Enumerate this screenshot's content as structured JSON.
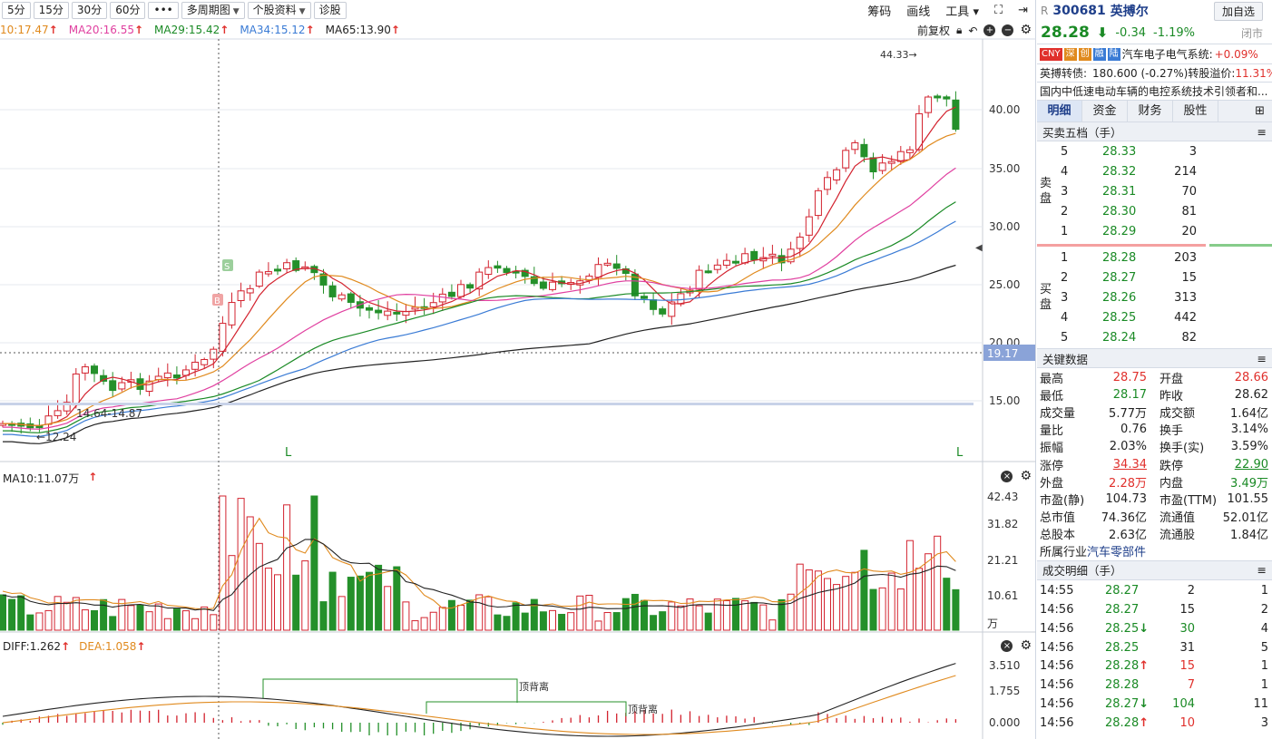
{
  "toolbar": {
    "periods": [
      "5分",
      "15分",
      "30分",
      "60分"
    ],
    "more": "•••",
    "multi": "多周期图",
    "profile": "个股资料",
    "diagnose": "诊股",
    "right": [
      "筹码",
      "画线",
      "工具"
    ]
  },
  "ma_legend": [
    {
      "label": "10:17.47",
      "color": "#e08a1e"
    },
    {
      "label": "MA20:16.55",
      "color": "#e040a0"
    },
    {
      "label": "MA29:15.42",
      "color": "#1a8a25"
    },
    {
      "label": "MA34:15.12",
      "color": "#3a7bd5"
    },
    {
      "label": "MA65:13.90",
      "color": "#222222"
    }
  ],
  "adj": "前复权",
  "price_axis": [
    "40.00",
    "35.00",
    "30.00",
    "25.00",
    "20.00",
    "15.00"
  ],
  "price_marks": {
    "high_label": "44.33→",
    "low_label": "←12.24",
    "range_label": "14.64-14.87",
    "cross_label": "19.17",
    "b": "B",
    "s": "S",
    "l": "L"
  },
  "vol_legend": "MA10:11.07万",
  "vol_axis": [
    "42.43",
    "31.82",
    "21.21",
    "10.61",
    "万"
  ],
  "macd_legend": {
    "diff": "DIFF:1.262",
    "dea": "DEA:1.058"
  },
  "macd_axis": [
    "3.510",
    "1.755",
    "0.000"
  ],
  "divergence": "顶背离",
  "stock": {
    "r": "R",
    "code": "300681",
    "name": "英搏尔",
    "price": "28.28",
    "change": "-0.34",
    "pct": "-1.19%",
    "add": "加自选",
    "status": "闭市",
    "tags": [
      "CNY",
      "深",
      "创",
      "融",
      "陆"
    ],
    "sector": "汽车电子电气系统:",
    "sector_pct": "+0.09%",
    "convert": "英搏转债:",
    "convert_val": "180.600 (-0.27%)",
    "premium": "转股溢价:",
    "premium_val": "11.31%",
    "desc": "国内中低速电动车辆的电控系统技术引领者和..."
  },
  "tabs": [
    "明细",
    "资金",
    "财务",
    "股性"
  ],
  "orderbook": {
    "title": "买卖五档（手）",
    "sell_label": "卖盘",
    "buy_label": "买盘",
    "sell": [
      {
        "n": "5",
        "p": "28.33",
        "v": "3"
      },
      {
        "n": "4",
        "p": "28.32",
        "v": "214"
      },
      {
        "n": "3",
        "p": "28.31",
        "v": "70"
      },
      {
        "n": "2",
        "p": "28.30",
        "v": "81"
      },
      {
        "n": "1",
        "p": "28.29",
        "v": "20"
      }
    ],
    "buy": [
      {
        "n": "1",
        "p": "28.28",
        "v": "203"
      },
      {
        "n": "2",
        "p": "28.27",
        "v": "15"
      },
      {
        "n": "3",
        "p": "28.26",
        "v": "313"
      },
      {
        "n": "4",
        "p": "28.25",
        "v": "442"
      },
      {
        "n": "5",
        "p": "28.24",
        "v": "82"
      }
    ]
  },
  "keydata": {
    "title": "关键数据",
    "rows": [
      [
        "最高",
        "28.75",
        "r",
        "开盘",
        "28.66",
        "r"
      ],
      [
        "最低",
        "28.17",
        "g",
        "昨收",
        "28.62",
        ""
      ],
      [
        "成交量",
        "5.77万",
        "",
        "成交额",
        "1.64亿",
        ""
      ],
      [
        "量比",
        "0.76",
        "",
        "换手",
        "3.14%",
        ""
      ],
      [
        "振幅",
        "2.03%",
        "",
        "换手(实)",
        "3.59%",
        ""
      ],
      [
        "涨停",
        "34.34",
        "ru",
        "跌停",
        "22.90",
        "gu"
      ],
      [
        "外盘",
        "2.28万",
        "r",
        "内盘",
        "3.49万",
        "g"
      ],
      [
        "市盈(静)",
        "104.73",
        "",
        "市盈(TTM)",
        "101.55",
        ""
      ],
      [
        "总市值",
        "74.36亿",
        "",
        "流通值",
        "52.01亿",
        ""
      ],
      [
        "总股本",
        "2.63亿",
        "",
        "流通股",
        "1.84亿",
        ""
      ]
    ],
    "industry_label": "所属行业",
    "industry": "汽车零部件"
  },
  "trades": {
    "title": "成交明细（手）",
    "rows": [
      [
        "14:55",
        "28.27",
        "",
        "2",
        "1",
        ""
      ],
      [
        "14:56",
        "28.27",
        "",
        "15",
        "2",
        ""
      ],
      [
        "14:56",
        "28.25",
        "down",
        "30",
        "4",
        "g"
      ],
      [
        "14:56",
        "28.25",
        "",
        "31",
        "5",
        ""
      ],
      [
        "14:56",
        "28.28",
        "up",
        "15",
        "1",
        "r"
      ],
      [
        "14:56",
        "28.28",
        "",
        "7",
        "1",
        "r"
      ],
      [
        "14:56",
        "28.27",
        "down",
        "104",
        "11",
        "g"
      ],
      [
        "14:56",
        "28.28",
        "up",
        "10",
        "3",
        "r"
      ]
    ]
  }
}
